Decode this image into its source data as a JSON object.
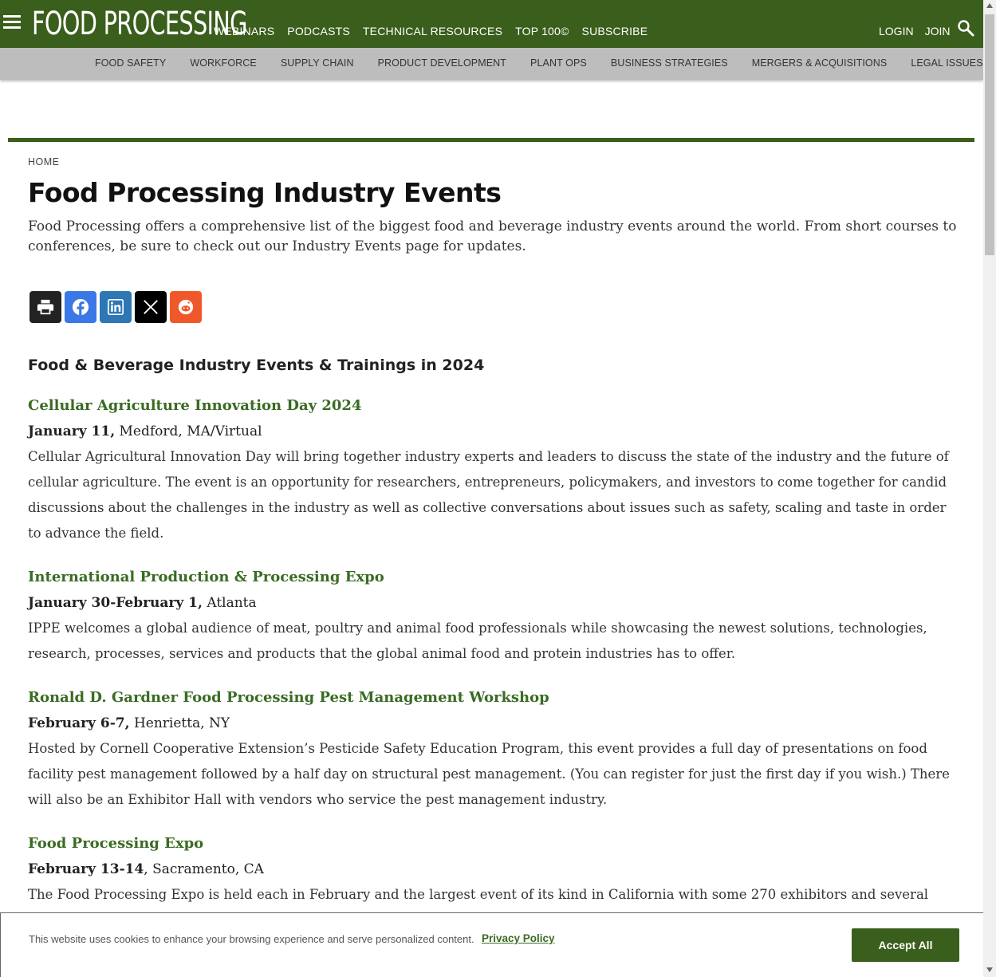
{
  "header": {
    "logo": "FOOD PROCESSING",
    "nav": [
      "WEBINARS",
      "PODCASTS",
      "TECHNICAL RESOURCES",
      "TOP 100©",
      "SUBSCRIBE"
    ],
    "login": "LOGIN",
    "join": "JOIN"
  },
  "subnav": [
    "FOOD SAFETY",
    "WORKFORCE",
    "SUPPLY CHAIN",
    "PRODUCT DEVELOPMENT",
    "PLANT OPS",
    "BUSINESS STRATEGIES",
    "MERGERS & ACQUISITIONS",
    "LEGAL ISSUES"
  ],
  "page": {
    "breadcrumb": "HOME",
    "title": "Food Processing Industry Events",
    "intro": "Food Processing offers a comprehensive list of the biggest food and beverage industry events around the world. From short courses to conferences, be sure to check out our Industry Events page for updates."
  },
  "share": [
    "print-icon",
    "facebook-icon",
    "linkedin-icon",
    "x-icon",
    "reddit-icon"
  ],
  "colors": {
    "brand_green": "#3a5e1c",
    "link_green": "#3a6b23",
    "subnav_grey": "#bdbdbd",
    "facebook": "#3b78e7",
    "linkedin": "#2d77b5",
    "x": "#000000",
    "reddit": "#f0582a"
  },
  "events_section": {
    "heading": "Food & Beverage Industry Events & Trainings in 2024",
    "events": [
      {
        "title": "Cellular Agriculture Innovation Day 2024",
        "date": "January 11,",
        "location": " Medford, MA/Virtual",
        "description": "Cellular Agricultural Innovation Day will bring together industry experts and leaders to discuss the state of the industry and the future of cellular agriculture. The event is an opportunity for researchers, entrepreneurs, policymakers, and investors to come together for candid discussions about the challenges in the industry as well as collective conversations about issues such as safety, scaling and taste in order to advance the field."
      },
      {
        "title": "International Production & Processing Expo",
        "date": "January 30-February 1,",
        "location": " Atlanta",
        "description": "IPPE welcomes a global audience of meat, poultry and animal food professionals while showcasing the newest solutions, technologies, research, processes, services and products that the global animal food and protein industries has to offer."
      },
      {
        "title": "Ronald D. Gardner Food Processing Pest Management Workshop",
        "date": "February 6-7,",
        "location": " Henrietta, NY",
        "description": "Hosted by Cornell Cooperative Extension’s Pesticide Safety Education Program, this event provides a full day of presentations on food facility pest management followed by a half day on structural pest management. (You can register for just the first day if you wish.) There will also be an Exhibitor Hall with vendors who service the pest management industry."
      },
      {
        "title": "Food Processing Expo",
        "date": "February 13-14",
        "location": ", Sacramento, CA",
        "description": "The Food Processing Expo is held each in February and the largest event of its kind in California with some 270 exhibitors and several thousand attendees. Many food processors make it a must attend event each year to visit the many vendors on the expansive trade show floor. The Expo also offers educational seminars about topical industry events."
      }
    ]
  },
  "cookie": {
    "text": "This website uses cookies to enhance your browsing experience and serve personalized content.",
    "policy_link": "Privacy Policy",
    "accept": "Accept All"
  }
}
